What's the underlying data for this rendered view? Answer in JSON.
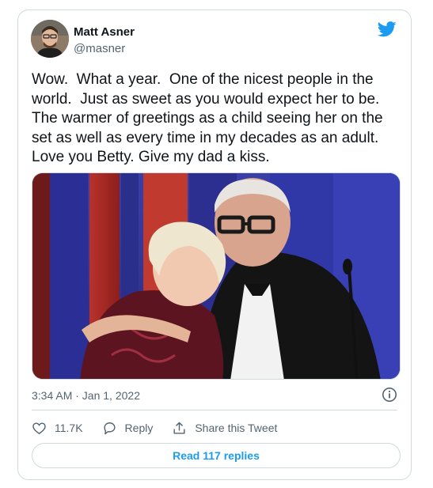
{
  "author": {
    "name": "Matt Asner",
    "handle": "@masner"
  },
  "tweet": {
    "text": "Wow.  What a year.  One of the nicest people in the world.  Just as sweet as you would expect her to be. The warmer of greetings as a child seeing her on the set as well as every time in my decades as an adult. Love you Betty. Give my dad a kiss.",
    "timestamp": "3:34 AM · Jan 1, 2022"
  },
  "actions": {
    "like_count": "11.7K",
    "reply_label": "Reply",
    "share_label": "Share this Tweet"
  },
  "read_replies_label": "Read 117 replies",
  "icons": [
    "twitter-bird-icon",
    "info-icon",
    "heart-icon",
    "reply-icon",
    "share-icon"
  ],
  "colors": {
    "brand_blue": "#1d9bf0",
    "text_primary": "#0f1419",
    "text_secondary": "#536471",
    "border": "#cfd9de"
  }
}
